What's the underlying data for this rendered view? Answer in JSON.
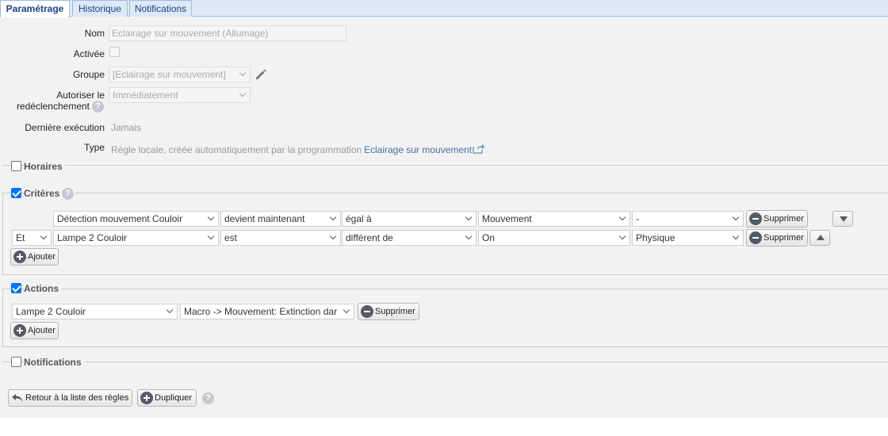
{
  "tabs": [
    {
      "label": "Paramétrage",
      "active": true
    },
    {
      "label": "Historique",
      "active": false
    },
    {
      "label": "Notifications",
      "active": false
    }
  ],
  "form": {
    "nom_label": "Nom",
    "nom_value": "Eclairage sur mouvement (Allumage)",
    "activee_label": "Activée",
    "activee_checked": false,
    "groupe_label": "Groupe",
    "groupe_value": "[Eclairage sur mouvement]",
    "autoriser_label_line1": "Autoriser le",
    "autoriser_label_line2": "redéclenchement",
    "autoriser_value": "Immédiatement",
    "derniere_label": "Dernière exécution",
    "derniere_value": "Jamais",
    "type_label": "Type",
    "type_text": "Règle locale, créée automatiquement par la programmation",
    "type_link": "Eclairage sur mouvement"
  },
  "sections": {
    "horaires": {
      "title": "Horaires",
      "checked": false
    },
    "criteres": {
      "title": "Critères",
      "checked": true
    },
    "actions": {
      "title": "Actions",
      "checked": true
    },
    "notifications": {
      "title": "Notifications",
      "checked": false
    }
  },
  "criteres_rows": [
    {
      "connector": "",
      "device": "Détection mouvement Couloir",
      "verb": "devient maintenant",
      "operator": "égal à",
      "value": "Mouvement",
      "extra": "-",
      "move": "down"
    },
    {
      "connector": "Et",
      "device": "Lampe 2 Couloir",
      "verb": "est",
      "operator": "différent de",
      "value": "On",
      "extra": "Physique",
      "move": "up"
    }
  ],
  "actions_rows": [
    {
      "device": "Lampe 2 Couloir",
      "command": "Macro -> Mouvement: Extinction dar"
    }
  ],
  "labels": {
    "supprimer": "Supprimer",
    "ajouter": "Ajouter",
    "retour": "Retour à la liste des règles",
    "dupliquer": "Dupliquer",
    "help_glyph": "?"
  },
  "colors": {
    "accent": "#0075ff",
    "tab_border": "#99bbe8",
    "tab_bg": "#dfe8f6",
    "panel_bg": "#f2f2f2",
    "link": "#4a6fa5"
  }
}
